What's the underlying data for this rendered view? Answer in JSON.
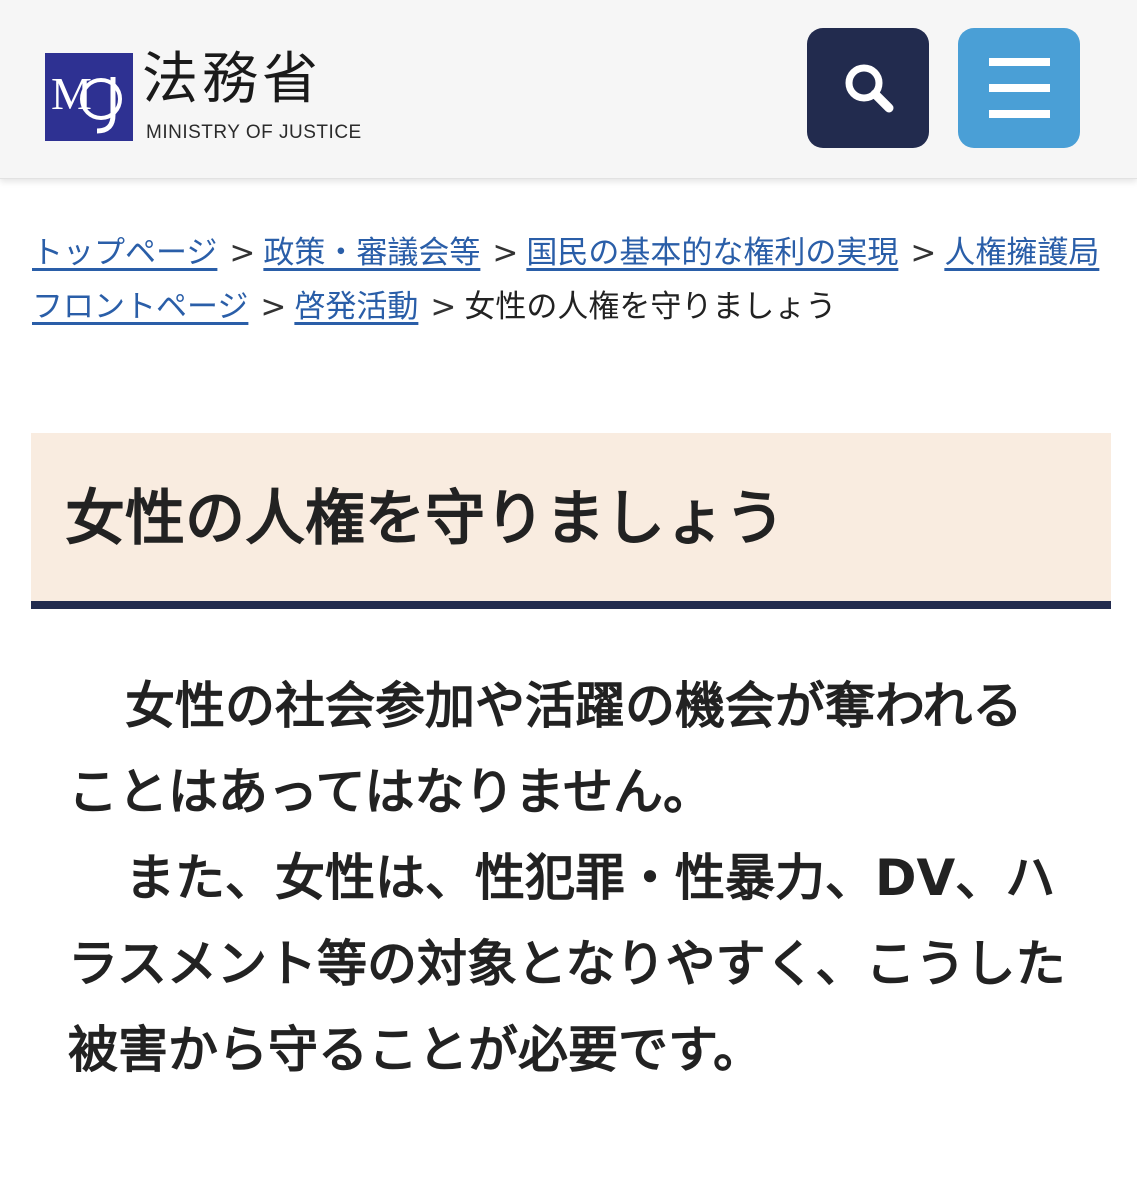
{
  "header": {
    "logo_mark_text": "MOJ",
    "logo_title": "法務省",
    "logo_subtitle": "MINISTRY OF JUSTICE",
    "search_icon": "search-icon",
    "menu_icon": "hamburger-menu-icon",
    "colors": {
      "logo": "#2e3192",
      "search_button": "#222b4e",
      "menu_button": "#4a9fd6"
    }
  },
  "breadcrumb": {
    "items": [
      "トップページ",
      "政策・審議会等",
      "国民の基本的な権利の実現",
      "人権擁護局フロントページ",
      "啓発活動"
    ],
    "separator": ">",
    "current": "女性の人権を守りましょう"
  },
  "page": {
    "title": "女性の人権を守りましょう",
    "title_bg": "#f9ece0",
    "paragraphs": [
      "女性の社会参加や活躍の機会が奪われることはあってはなりません。",
      "また、女性は、性犯罪・性暴力、DV、ハラスメント等の対象となりやすく、こうした被害から守ることが必要です。"
    ]
  }
}
